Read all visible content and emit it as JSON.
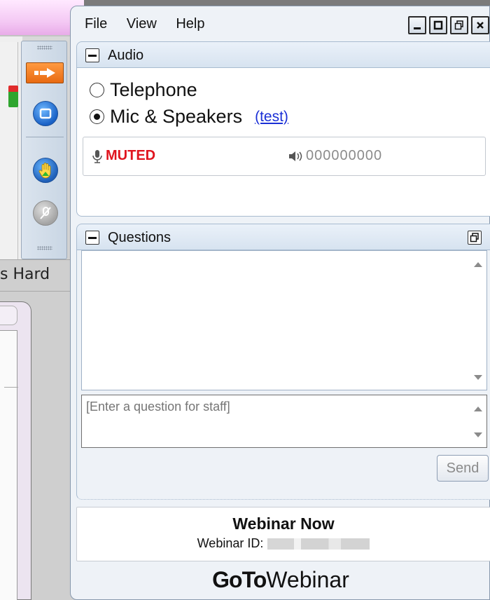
{
  "menu": {
    "file": "File",
    "view": "View",
    "help": "Help"
  },
  "background": {
    "partial_text": "s Hard"
  },
  "audio": {
    "title": "Audio",
    "telephone_label": "Telephone",
    "mic_label": "Mic & Speakers",
    "test_link": "(test)",
    "selected": "Mic & Speakers",
    "muted_label": "MUTED",
    "level_meter": "000000000"
  },
  "questions": {
    "title": "Questions",
    "input_placeholder": "[Enter a question for staff]",
    "send_label": "Send"
  },
  "webinar": {
    "name": "Webinar Now",
    "id_label": "Webinar ID:"
  },
  "brand": {
    "goto": "GoTo",
    "webinar": "Webinar"
  },
  "colors": {
    "muted": "#e0141e",
    "link": "#1a2fd6",
    "panel_bg": "#eef2f7",
    "accent_orange": "#e86a12"
  },
  "icons": [
    "minimize-icon",
    "maximize-icon",
    "restore-icon",
    "close-icon",
    "microphone-icon",
    "speaker-icon",
    "popout-icon",
    "hand-raise-icon",
    "screen-icon",
    "arrow-right-icon"
  ]
}
